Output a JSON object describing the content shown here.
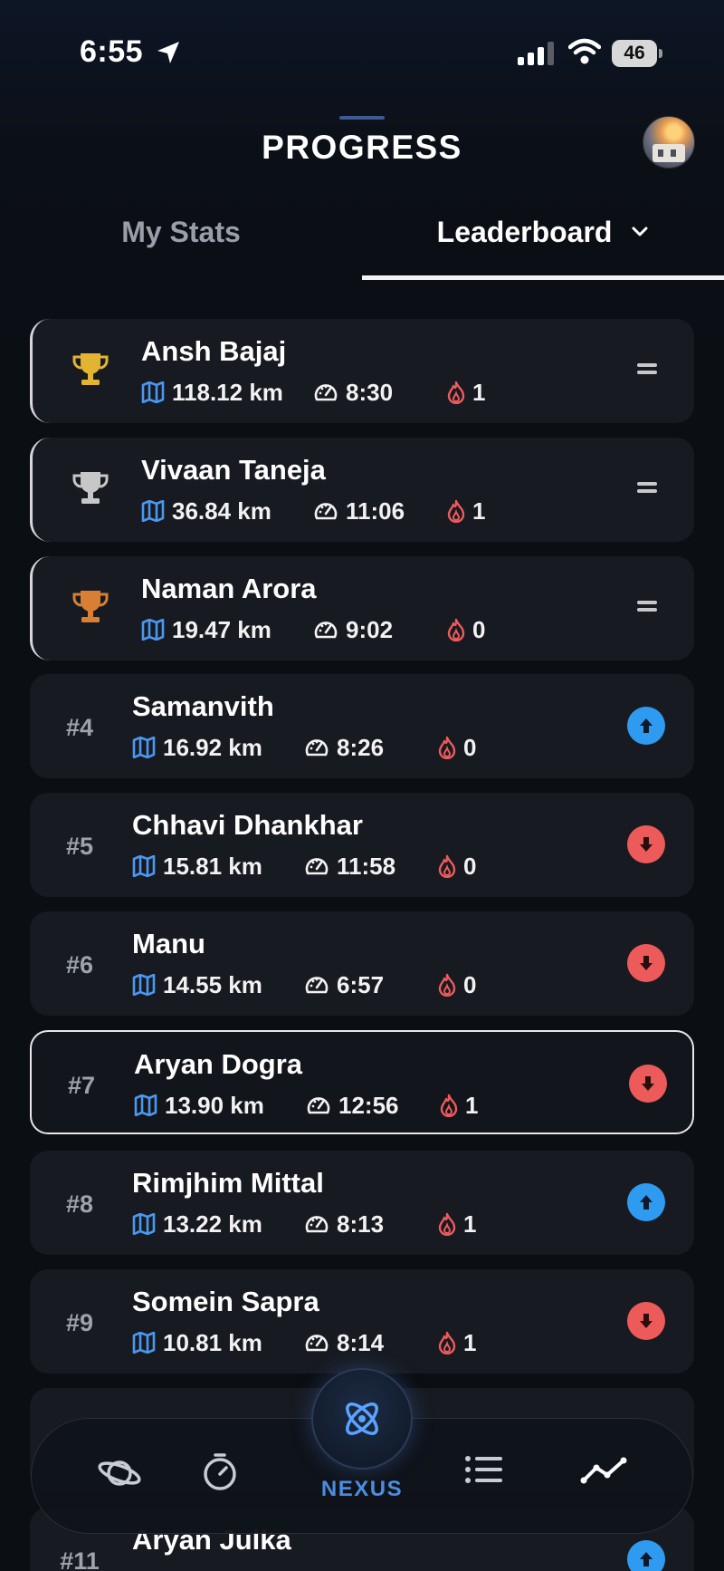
{
  "status_bar": {
    "time": "6:55",
    "battery": "46"
  },
  "header": {
    "title": "PROGRESS"
  },
  "tabs": {
    "my_stats": "My Stats",
    "leaderboard": "Leaderboard"
  },
  "colors": {
    "accent": "#4d8de0",
    "up": "#2f9bf0",
    "down": "#ec5a5a",
    "gold": "#e2b431",
    "silver": "#c7c7c7",
    "bronze": "#d97f33"
  },
  "leaderboard": [
    {
      "name": "Ansh Bajaj",
      "distance": "118.12 km",
      "pace": "8:30",
      "streak": "1",
      "trophy": "gold",
      "trend": "same"
    },
    {
      "name": "Vivaan Taneja",
      "distance": "36.84 km",
      "pace": "11:06",
      "streak": "1",
      "trophy": "silver",
      "trend": "same"
    },
    {
      "name": "Naman Arora",
      "distance": "19.47 km",
      "pace": "9:02",
      "streak": "0",
      "trophy": "bronze",
      "trend": "same"
    },
    {
      "rank": "#4",
      "name": "Samanvith",
      "distance": "16.92 km",
      "pace": "8:26",
      "streak": "0",
      "trend": "up"
    },
    {
      "rank": "#5",
      "name": "Chhavi Dhankhar",
      "distance": "15.81 km",
      "pace": "11:58",
      "streak": "0",
      "trend": "down"
    },
    {
      "rank": "#6",
      "name": "Manu",
      "distance": "14.55 km",
      "pace": "6:57",
      "streak": "0",
      "trend": "down"
    },
    {
      "rank": "#7",
      "name": "Aryan Dogra",
      "distance": "13.90 km",
      "pace": "12:56",
      "streak": "1",
      "trend": "down",
      "current_user": true
    },
    {
      "rank": "#8",
      "name": "Rimjhim Mittal",
      "distance": "13.22 km",
      "pace": "8:13",
      "streak": "1",
      "trend": "up"
    },
    {
      "rank": "#9",
      "name": "Somein Sapra",
      "distance": "10.81 km",
      "pace": "8:14",
      "streak": "1",
      "trend": "down"
    },
    {
      "rank": "",
      "name": "",
      "distance": "",
      "pace": "",
      "streak": "",
      "trend": ""
    },
    {
      "rank": "#11",
      "name": "Aryan Julka",
      "distance": "",
      "pace": "",
      "streak": "",
      "trend": "up"
    }
  ],
  "bottom_nav": {
    "items": [
      "planet-icon",
      "stopwatch-icon",
      "nexus-icon",
      "list-icon",
      "progress-chart-icon"
    ],
    "center_label": "NEXUS"
  }
}
